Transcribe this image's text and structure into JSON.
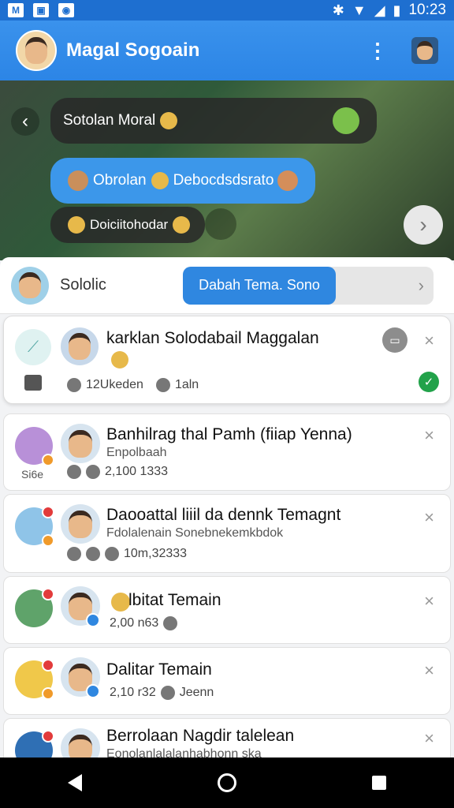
{
  "status_bar": {
    "time": "10:23",
    "left_icons": [
      "mail-icon",
      "image-icon",
      "app-icon"
    ],
    "right_icons": [
      "bluetooth-icon",
      "wifi-icon",
      "signal-icon",
      "battery-icon"
    ]
  },
  "app_bar": {
    "title": "Magal Sogoain",
    "menu_icon": "more-vert-icon"
  },
  "chat": {
    "bubble1": "Sotolan Moral",
    "bubble2_a": "Obrolan",
    "bubble2_b": "Debocdsdsrato",
    "bubble3": "Doiciitohodar"
  },
  "group": {
    "label": "Sololic",
    "pill": "Dabah Tema. Sono"
  },
  "featured": {
    "title": "karklan Solodabail Maggalan",
    "meta_a": "12Ukeden",
    "meta_b": "1aln"
  },
  "rows": [
    {
      "title": "Banhilrag thal Pamh (fiiap Yenna)",
      "sub": "Enpolbaah",
      "meta": "2,100 1333",
      "lead_label": "Si6e"
    },
    {
      "title": "Daooattal liiil da dennk Temagnt",
      "sub": "Fdolalenain Sonebnekemkbdok",
      "meta": "10m,32333"
    },
    {
      "title": "lbitat Temain",
      "meta": "2,00 n63"
    },
    {
      "title": "Dalitar Temain",
      "meta": "2,10 r32",
      "meta_b": "Jeenn"
    },
    {
      "title": "Berrolaan Nagdir talelean",
      "sub": "Eonolanlalalanhabhonn ska"
    }
  ],
  "colors": {
    "primary": "#2c85e6",
    "accent_green": "#22a24a"
  }
}
